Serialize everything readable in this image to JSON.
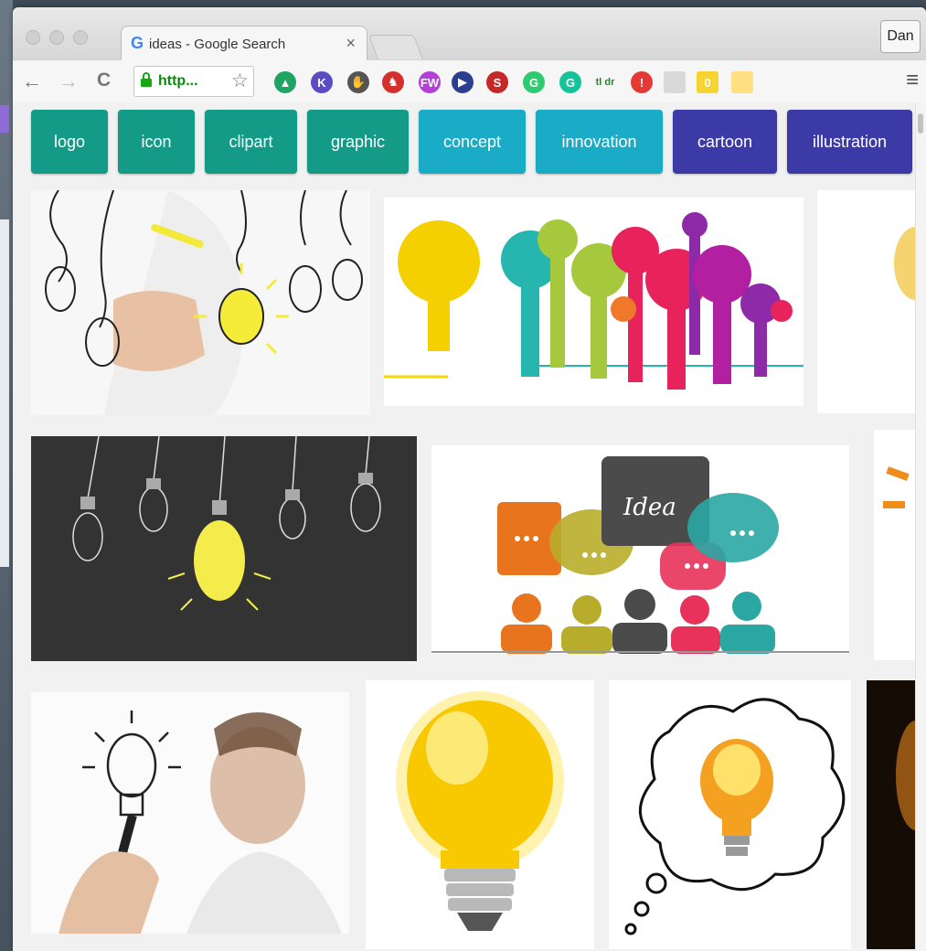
{
  "window": {
    "tab_title": "ideas - Google Search",
    "tab_close": "×",
    "user_button": "Dan"
  },
  "toolbar": {
    "back": "←",
    "forward": "→",
    "reload": "C",
    "url": "http...",
    "star": "☆",
    "menu": "≡",
    "extensions": [
      {
        "name": "google-drive",
        "label": "▲",
        "color": "#1fa463"
      },
      {
        "name": "k",
        "label": "K",
        "color": "#5b4cc4"
      },
      {
        "name": "evernote",
        "label": "✋",
        "color": "#555555"
      },
      {
        "name": "chair",
        "label": "♞",
        "color": "#d32f2f"
      },
      {
        "name": "puzzle",
        "label": "FW",
        "color": "#b23fd6"
      },
      {
        "name": "play",
        "label": "▶",
        "color": "#2c3e8f"
      },
      {
        "name": "s",
        "label": "S",
        "color": "#c62828"
      },
      {
        "name": "g-green",
        "label": "G",
        "color": "#2ecc71"
      },
      {
        "name": "grammarly",
        "label": "G",
        "color": "#15c39a"
      },
      {
        "name": "tldr",
        "label": "tl dr",
        "color": "#2e7d32"
      },
      {
        "name": "info",
        "label": "!",
        "color": "#e53935"
      },
      {
        "name": "grey",
        "label": "",
        "color": "#d9d9d9"
      },
      {
        "name": "yellow-badge",
        "label": "0",
        "color": "#f7d531"
      },
      {
        "name": "notes",
        "label": "",
        "color": "#ffe082"
      }
    ]
  },
  "chips": [
    {
      "label": "logo",
      "color": "#139b88",
      "width": 84
    },
    {
      "label": "icon",
      "color": "#139b88",
      "width": 84
    },
    {
      "label": "clipart",
      "color": "#139b88",
      "width": 101
    },
    {
      "label": "graphic",
      "color": "#139b88",
      "width": 111
    },
    {
      "label": "concept",
      "color": "#1aabc7",
      "width": 117
    },
    {
      "label": "innovation",
      "color": "#1aabc7",
      "width": 139
    },
    {
      "label": "cartoon",
      "color": "#3c3aa6",
      "width": 114
    },
    {
      "label": "illustration",
      "color": "#3c3aa6",
      "width": 137
    }
  ],
  "thumbnails": [
    {
      "label": "hand drawing light bulbs",
      "word": ""
    },
    {
      "label": "colorful bulb icons",
      "word": ""
    },
    {
      "label": "partial right thumbnail 1",
      "word": ""
    },
    {
      "label": "chalkboard light bulbs",
      "word": ""
    },
    {
      "label": "people speech bubbles",
      "word": "Idea"
    },
    {
      "label": "partial right thumbnail 2",
      "word": ""
    },
    {
      "label": "man drawing bulb",
      "word": ""
    },
    {
      "label": "glossy yellow bulb",
      "word": ""
    },
    {
      "label": "thought bubble bulb",
      "word": ""
    },
    {
      "label": "dark bulb partial",
      "word": ""
    }
  ]
}
